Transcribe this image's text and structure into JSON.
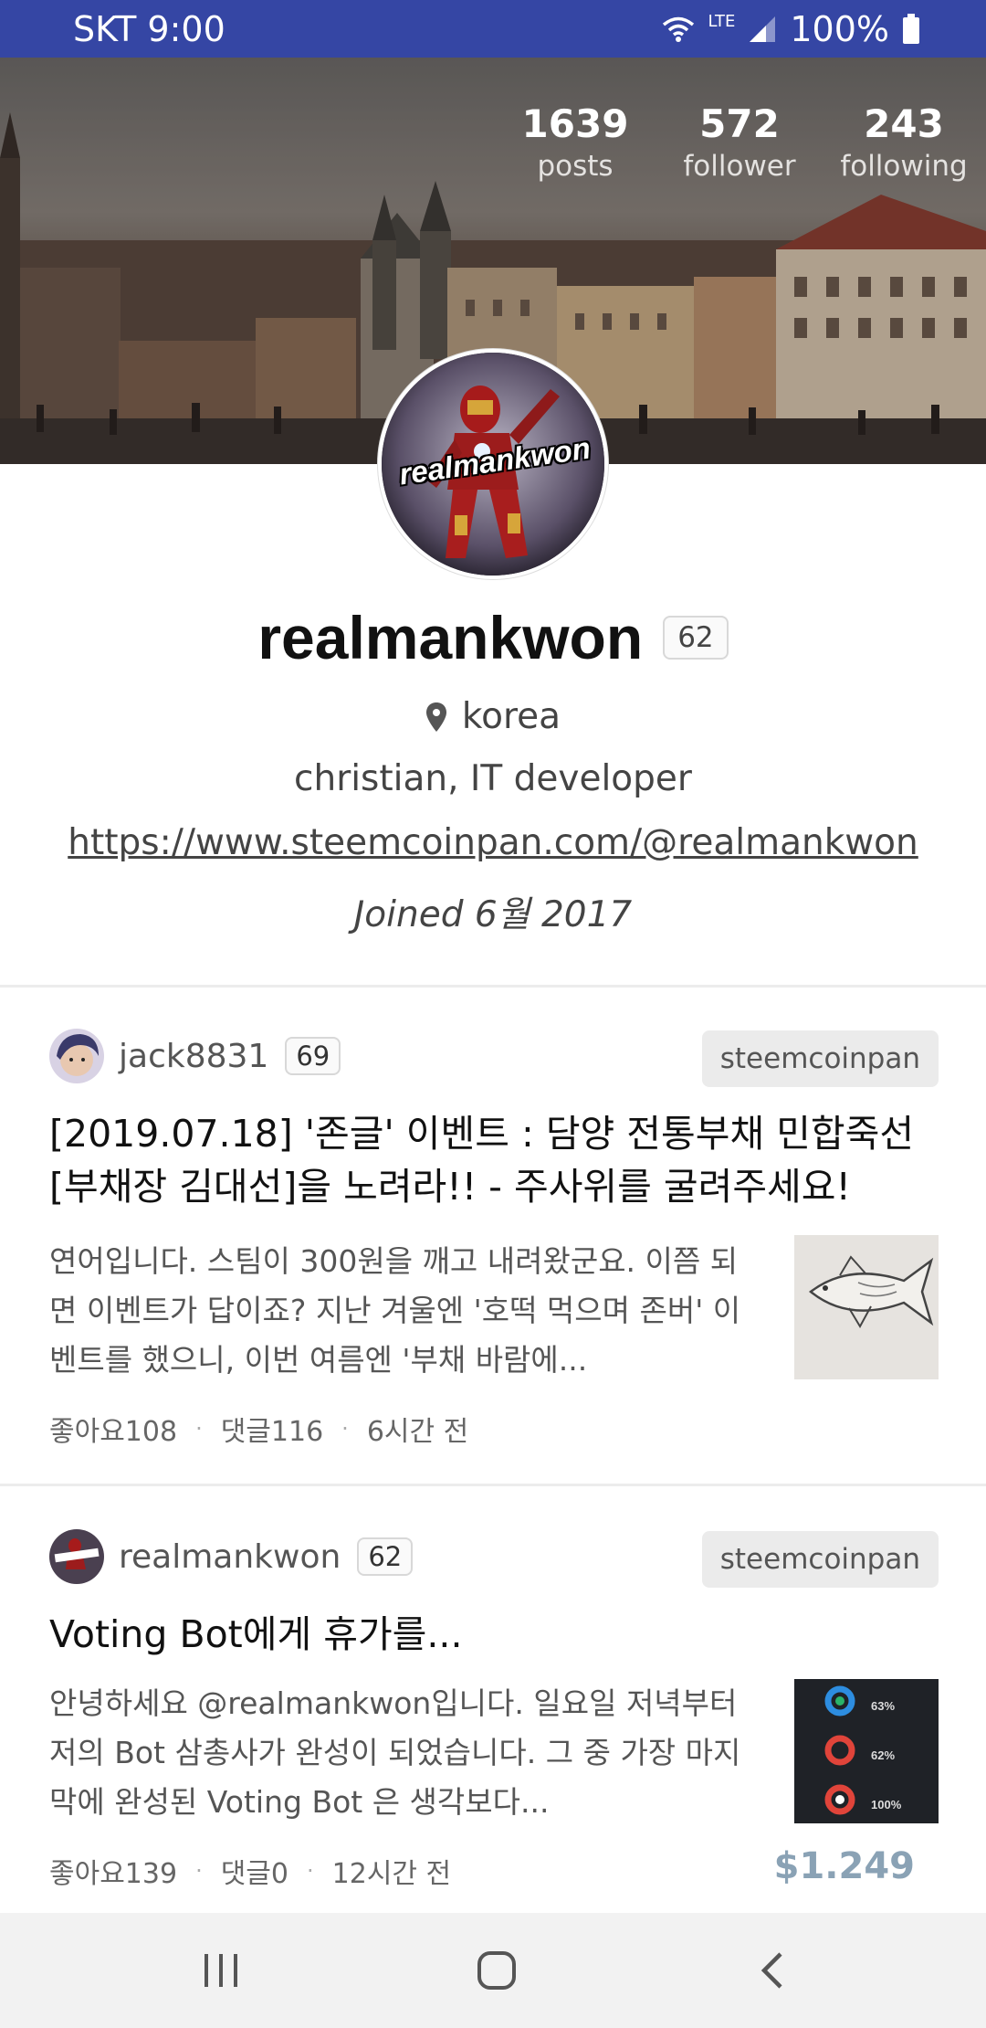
{
  "status_bar": {
    "carrier": "SKT",
    "time": "9:00",
    "network": "LTE",
    "battery": "100%"
  },
  "profile": {
    "stats": [
      {
        "value": "1639",
        "label": "posts"
      },
      {
        "value": "572",
        "label": "follower"
      },
      {
        "value": "243",
        "label": "following"
      }
    ],
    "avatar_text": "realmankwon",
    "username": "realmankwon",
    "reputation": "62",
    "location": "korea",
    "about": "christian, IT developer",
    "website": "https://www.steemcoinpan.com/@realmankwon",
    "joined": "Joined 6월 2017"
  },
  "posts": [
    {
      "author": "jack8831",
      "reputation": "69",
      "tag": "steemcoinpan",
      "title": "[2019.07.18] '존글' 이벤트 : 담양 전통부채 민합죽선 [부채장 김대선]을 노려라!! - 주사위를 굴려주세요!",
      "excerpt": "연어입니다. 스팀이 300원을 깨고 내려왔군요. 이쯤 되면 이벤트가 답이죠? 지난 겨울엔 '호떡 먹으며 존버' 이벤트를 했으니, 이번 여름엔 '부채 바람에...",
      "likes": "좋아요108",
      "comments": "댓글116",
      "time": "6시간 전",
      "payout": ""
    },
    {
      "author": "realmankwon",
      "reputation": "62",
      "tag": "steemcoinpan",
      "title": "Voting Bot에게 휴가를...",
      "excerpt": "안녕하세요 @realmankwon입니다. 일요일 저녁부터 저의 Bot 삼총사가 완성이 되었습니다. 그 중 가장 마지막에 완성된 Voting Bot 은 생각보다...",
      "likes": "좋아요139",
      "comments": "댓글0",
      "time": "12시간 전",
      "payout": "$1.249",
      "thumb_labels": [
        "63%",
        "62%",
        "100%"
      ]
    }
  ],
  "colors": {
    "status_bar": "#3546a4",
    "payout": "#8aa2b5",
    "tag_bg": "#ebebeb"
  }
}
